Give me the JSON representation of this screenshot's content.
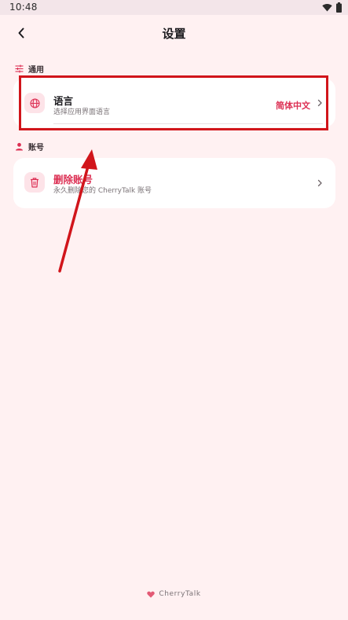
{
  "status_bar": {
    "time": "10:48"
  },
  "header": {
    "title": "设置"
  },
  "sections": {
    "general": {
      "label": "通用",
      "language_row": {
        "title": "语言",
        "subtitle": "选择应用界面语言",
        "value": "简体中文"
      }
    },
    "account": {
      "label": "账号",
      "delete_row": {
        "title": "删除账号",
        "subtitle": "永久删除您的 CherryTalk 账号"
      }
    }
  },
  "footer": {
    "brand": "CherryTalk"
  },
  "colors": {
    "accent": "#dc2f53",
    "background": "#fff1f2",
    "annotation": "#d1151b"
  }
}
